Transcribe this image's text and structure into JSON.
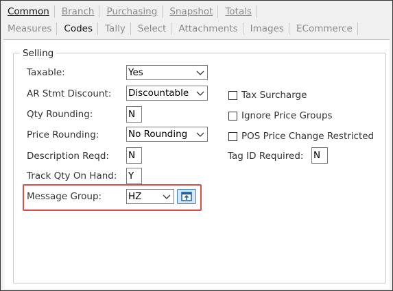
{
  "tabs_row1": [
    {
      "label": "Common",
      "active": true
    },
    {
      "label": "Branch",
      "active": false
    },
    {
      "label": "Purchasing",
      "active": false
    },
    {
      "label": "Snapshot",
      "active": false
    },
    {
      "label": "Totals",
      "active": false
    }
  ],
  "tabs_row2": [
    {
      "label": "Measures",
      "active": false
    },
    {
      "label": "Codes",
      "active": true
    },
    {
      "label": "Tally",
      "active": false
    },
    {
      "label": "Select",
      "active": false
    },
    {
      "label": "Attachments",
      "active": false
    },
    {
      "label": "Images",
      "active": false
    },
    {
      "label": "ECommerce",
      "active": false
    }
  ],
  "group_title": "Selling",
  "fields": {
    "taxable": {
      "label": "Taxable:",
      "value": "Yes"
    },
    "ar_stmt_discount": {
      "label": "AR Stmt Discount:",
      "value": "Discountable"
    },
    "qty_rounding": {
      "label": "Qty Rounding:",
      "value": "N"
    },
    "price_rounding": {
      "label": "Price Rounding:",
      "value": "No Rounding"
    },
    "description_reqd": {
      "label": "Description Reqd:",
      "value": "N"
    },
    "track_qty_on_hand": {
      "label": "Track Qty On Hand:",
      "value": "Y"
    },
    "message_group": {
      "label": "Message Group:",
      "value": "HZ"
    }
  },
  "checkboxes": {
    "tax_surcharge": {
      "label": "Tax Surcharge",
      "checked": false
    },
    "ignore_price_groups": {
      "label": "Ignore Price Groups",
      "checked": false
    },
    "pos_price_change_restricted": {
      "label": "POS Price Change Restricted",
      "checked": false
    }
  },
  "tag_id_required": {
    "label": "Tag ID Required:",
    "value": "N"
  },
  "icons": {
    "message_group_lookup": "open-lookup-icon",
    "dropdown": "chevron-down-icon"
  },
  "colors": {
    "highlight": "#e24a45",
    "icon_button": "#3c7fc4"
  }
}
